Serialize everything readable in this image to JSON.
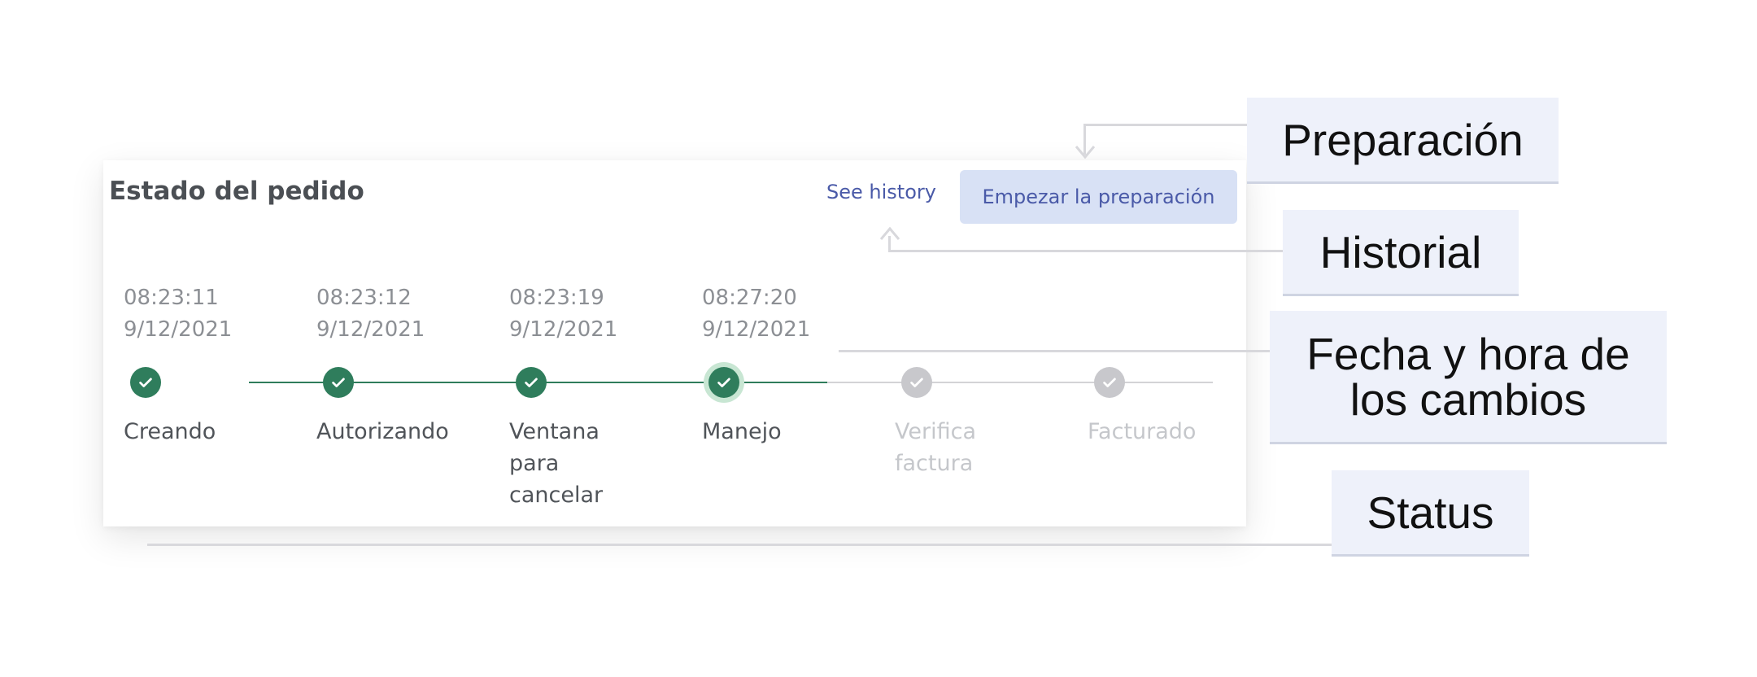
{
  "card": {
    "title": "Estado del pedido",
    "history_link": "See history",
    "prep_button": "Empezar la preparación"
  },
  "steps": [
    {
      "time": "08:23:11",
      "date": "9/12/2021",
      "label": "Creando",
      "state": "done"
    },
    {
      "time": "08:23:12",
      "date": "9/12/2021",
      "label": "Autorizando",
      "state": "done"
    },
    {
      "time": "08:23:19",
      "date": "9/12/2021",
      "label": "Ventana para cancelar",
      "state": "done"
    },
    {
      "time": "08:27:20",
      "date": "9/12/2021",
      "label": "Manejo",
      "state": "current"
    },
    {
      "time": "",
      "date": "",
      "label": "Verifica factura",
      "state": "pending"
    },
    {
      "time": "",
      "date": "",
      "label": "Facturado",
      "state": "pending"
    }
  ],
  "callouts": {
    "preparacion": "Preparación",
    "historial": "Historial",
    "fecha_line1": "Fecha y hora de",
    "fecha_line2": "los cambios",
    "status": "Status"
  },
  "icons": {
    "step_done": "check-icon",
    "arrow_down": "arrow-down-icon",
    "arrow_up": "arrow-up-icon"
  },
  "colors": {
    "done": "#2f7d5c",
    "current_ring": "#c8e6d3",
    "pending": "#c8c8cc",
    "accent": "#4a5aa8",
    "button_bg": "#d8e1f5",
    "callout_bg": "#eef1fa"
  }
}
